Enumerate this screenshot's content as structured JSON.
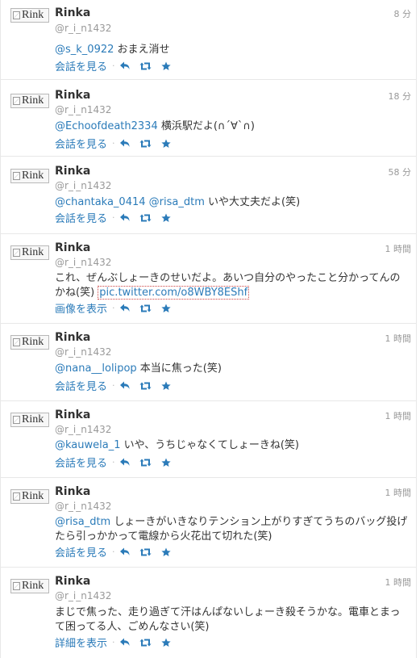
{
  "tweets": [
    {
      "avatar_alt": "Rink",
      "name": "Rinka",
      "handle": "@r_i_n1432",
      "time": "8 分",
      "mention": "@s_k_0922",
      "text": " おまえ消せ",
      "action": "会話を見る"
    },
    {
      "avatar_alt": "Rink",
      "name": "Rinka",
      "handle": "@r_i_n1432",
      "time": "18 分",
      "mention": "@Echoofdeath2334",
      "text": " 横浜駅だよ(∩´∀`∩)",
      "action": "会話を見る"
    },
    {
      "avatar_alt": "Rink",
      "name": "Rinka",
      "handle": "@r_i_n1432",
      "time": "58 分",
      "mention": "@chantaka_0414",
      "mention2": "@risa_dtm",
      "text": " いや大丈夫だよ(笑)",
      "action": "会話を見る"
    },
    {
      "avatar_alt": "Rink",
      "name": "Rinka",
      "handle": "@r_i_n1432",
      "time": "1 時間",
      "text": "これ、ぜんぶしょーきのせいだよ。あいつ自分のやったこと分かってんのかね(笑)",
      "link": "pic.twitter.com/o8WBY8EShf",
      "action": "画像を表示"
    },
    {
      "avatar_alt": "Rink",
      "name": "Rinka",
      "handle": "@r_i_n1432",
      "time": "1 時間",
      "mention": "@nana__lolipop",
      "text": " 本当に焦った(笑)",
      "action": "会話を見る"
    },
    {
      "avatar_alt": "Rink",
      "name": "Rinka",
      "handle": "@r_i_n1432",
      "time": "1 時間",
      "mention": "@kauwela_1",
      "text": " いや、うちじゃなくてしょーきね(笑)",
      "action": "会話を見る"
    },
    {
      "avatar_alt": "Rink",
      "name": "Rinka",
      "handle": "@r_i_n1432",
      "time": "1 時間",
      "mention": "@risa_dtm",
      "text": " しょーきがいきなりテンション上がりすぎてうちのバッグ投げたら引っかかって電線から火花出て切れた(笑)",
      "action": "会話を見る"
    },
    {
      "avatar_alt": "Rink",
      "name": "Rinka",
      "handle": "@r_i_n1432",
      "time": "1 時間",
      "text": "まじで焦った、走り過ぎて汗はんぱないしょーき殺そうかな。電車とまって困ってる人、ごめんなさい(笑)",
      "action": "詳細を表示"
    }
  ],
  "icons": [
    "reply-icon",
    "retweet-icon",
    "favorite-icon"
  ],
  "colors": {
    "link": "#2b7bb9",
    "name": "#333333",
    "meta": "#999999",
    "border": "#e8e8e8"
  }
}
